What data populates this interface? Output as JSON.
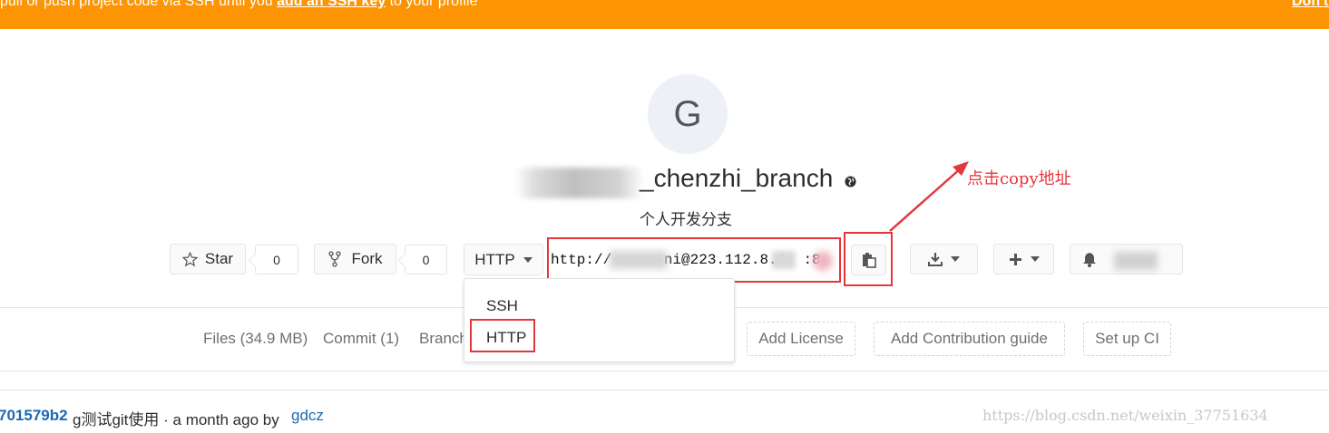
{
  "banner": {
    "prefix": "pull or push project code via SSH until you ",
    "link": "add an SSH key",
    "suffix": " to your profile",
    "dismiss": "Don't show again",
    "color": "#fc9403"
  },
  "project": {
    "avatar_letter": "G",
    "title": "_chenzhi_branch",
    "description": "个人开发分支"
  },
  "actions": {
    "star_label": "Star",
    "star_count": "0",
    "fork_label": "Fork",
    "fork_count": "0",
    "protocol": "HTTP",
    "clone_url": "http://      ni@223.112.8.1  :8"
  },
  "protocol_menu": {
    "options": [
      "SSH",
      "HTTP"
    ],
    "selected": "HTTP"
  },
  "nav": {
    "files": "Files (34.9 MB)",
    "commits": "Commit (1)",
    "branches": "Branch",
    "add_license": "Add License",
    "add_contribution": "Add Contribution guide",
    "setup_ci": "Set up CI"
  },
  "commit": {
    "sha": "701579b2",
    "message": "g测试git使用 · a month ago by ",
    "author": "gdcz"
  },
  "annotation": {
    "text": "点击copy地址",
    "color": "#e5363c"
  },
  "watermark": "https://blog.csdn.net/weixin_37751634"
}
